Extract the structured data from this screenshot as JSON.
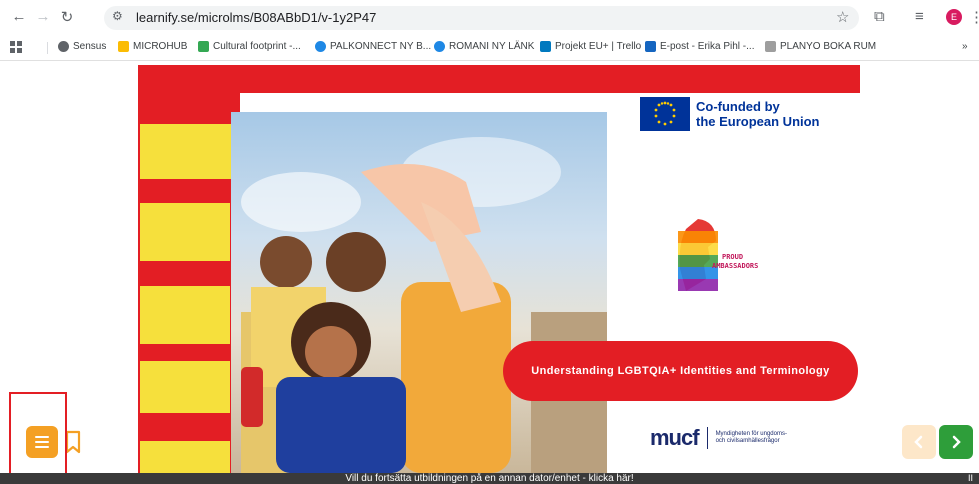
{
  "browser": {
    "url": "learnify.se/microlms/B08ABbD1/v-1y2P47",
    "profile_initial": "E",
    "bookmarks": [
      {
        "label": "Sensus",
        "color": "#5f6368"
      },
      {
        "label": "MICROHUB",
        "color": "#1a73e8"
      },
      {
        "label": "Cultural footprint -...",
        "color": "#34a853"
      },
      {
        "label": "PALKONNECT NY B...",
        "color": "#1e88e5"
      },
      {
        "label": "ROMANI NY LÄNK",
        "color": "#1e88e5"
      },
      {
        "label": "Projekt EU+ | Trello",
        "color": "#0079bf"
      },
      {
        "label": "E-post - Erika Pihl -...",
        "color": "#1565c0"
      },
      {
        "label": "PLANYO BOKA RUM",
        "color": "#9e9e9e"
      }
    ],
    "more_bookmarks": "»"
  },
  "slide": {
    "eu_funding_line1": "Co-funded by",
    "eu_funding_line2": "the European Union",
    "proud_line1": "PROUD",
    "proud_line2": "AMBASSADORS",
    "title": "Understanding LGBTQIA+ Identities and Terminology",
    "mucf_logo": "mucf",
    "mucf_sub_line1": "Myndigheten för ungdoms-",
    "mucf_sub_line2": "och civilsamhällesfrågor"
  },
  "footer": {
    "banner_text": "Vill du fortsätta utbildningen på en annan dator/enhet - klicka här!",
    "banner_right": "II"
  },
  "colors": {
    "accent_red": "#e31e24",
    "accent_yellow": "#f6e03c",
    "menu_orange": "#f4a024",
    "next_green": "#2e9e3a"
  }
}
